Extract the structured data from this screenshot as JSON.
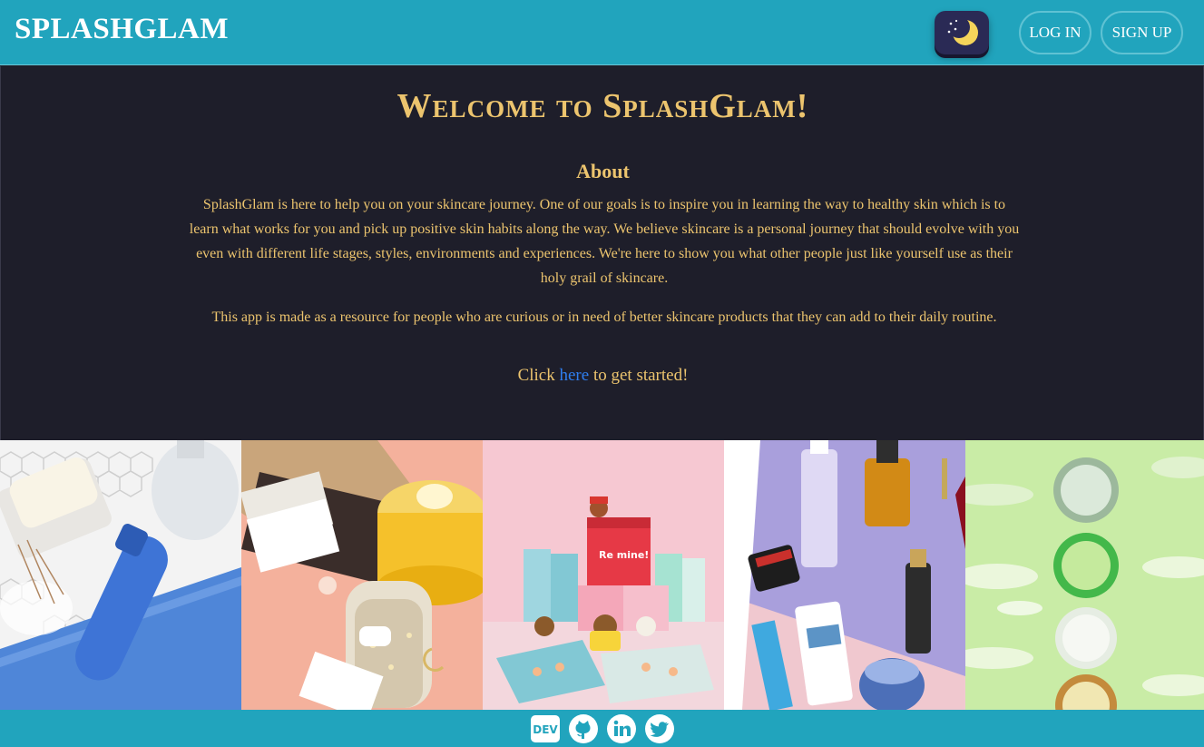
{
  "header": {
    "brand": "SPLASHGLAM",
    "login_label": "LOG IN",
    "signup_label": "SIGN UP",
    "theme_toggle_icon": "moon-icon"
  },
  "main": {
    "title": "Welcome to SplashGlam!",
    "about_heading": "About",
    "paragraph_1": "SplashGlam is here to help you on your skincare journey. One of our goals is to inspire you in learning the way to healthy skin which is to learn what works for you and pick up positive skin habits along the way. We believe skincare is a personal journey that should evolve with you even with different life stages, styles, environments and experiences. We're here to show you what other people just like yourself use as their holy grail of skincare.",
    "paragraph_2": "This app is made as a resource for people who are curious or in need of better skincare products that they can add to their daily routine.",
    "cta_prefix": "Click ",
    "cta_link": "here",
    "cta_suffix": " to get started!"
  },
  "gallery": {
    "images": [
      "sunscreen-tiles-image",
      "cleansing-balm-image",
      "line-friends-set-image",
      "skincare-bottles-image",
      "cream-jars-image"
    ],
    "box_label": "Re mine!"
  },
  "footer": {
    "icons": [
      "dev-icon",
      "github-icon",
      "linkedin-icon",
      "twitter-icon"
    ]
  },
  "colors": {
    "header_bg": "#21a4bd",
    "page_bg": "#1e1e2a",
    "accent_gold": "#ecc46e",
    "link_blue": "#2f7ff0"
  }
}
